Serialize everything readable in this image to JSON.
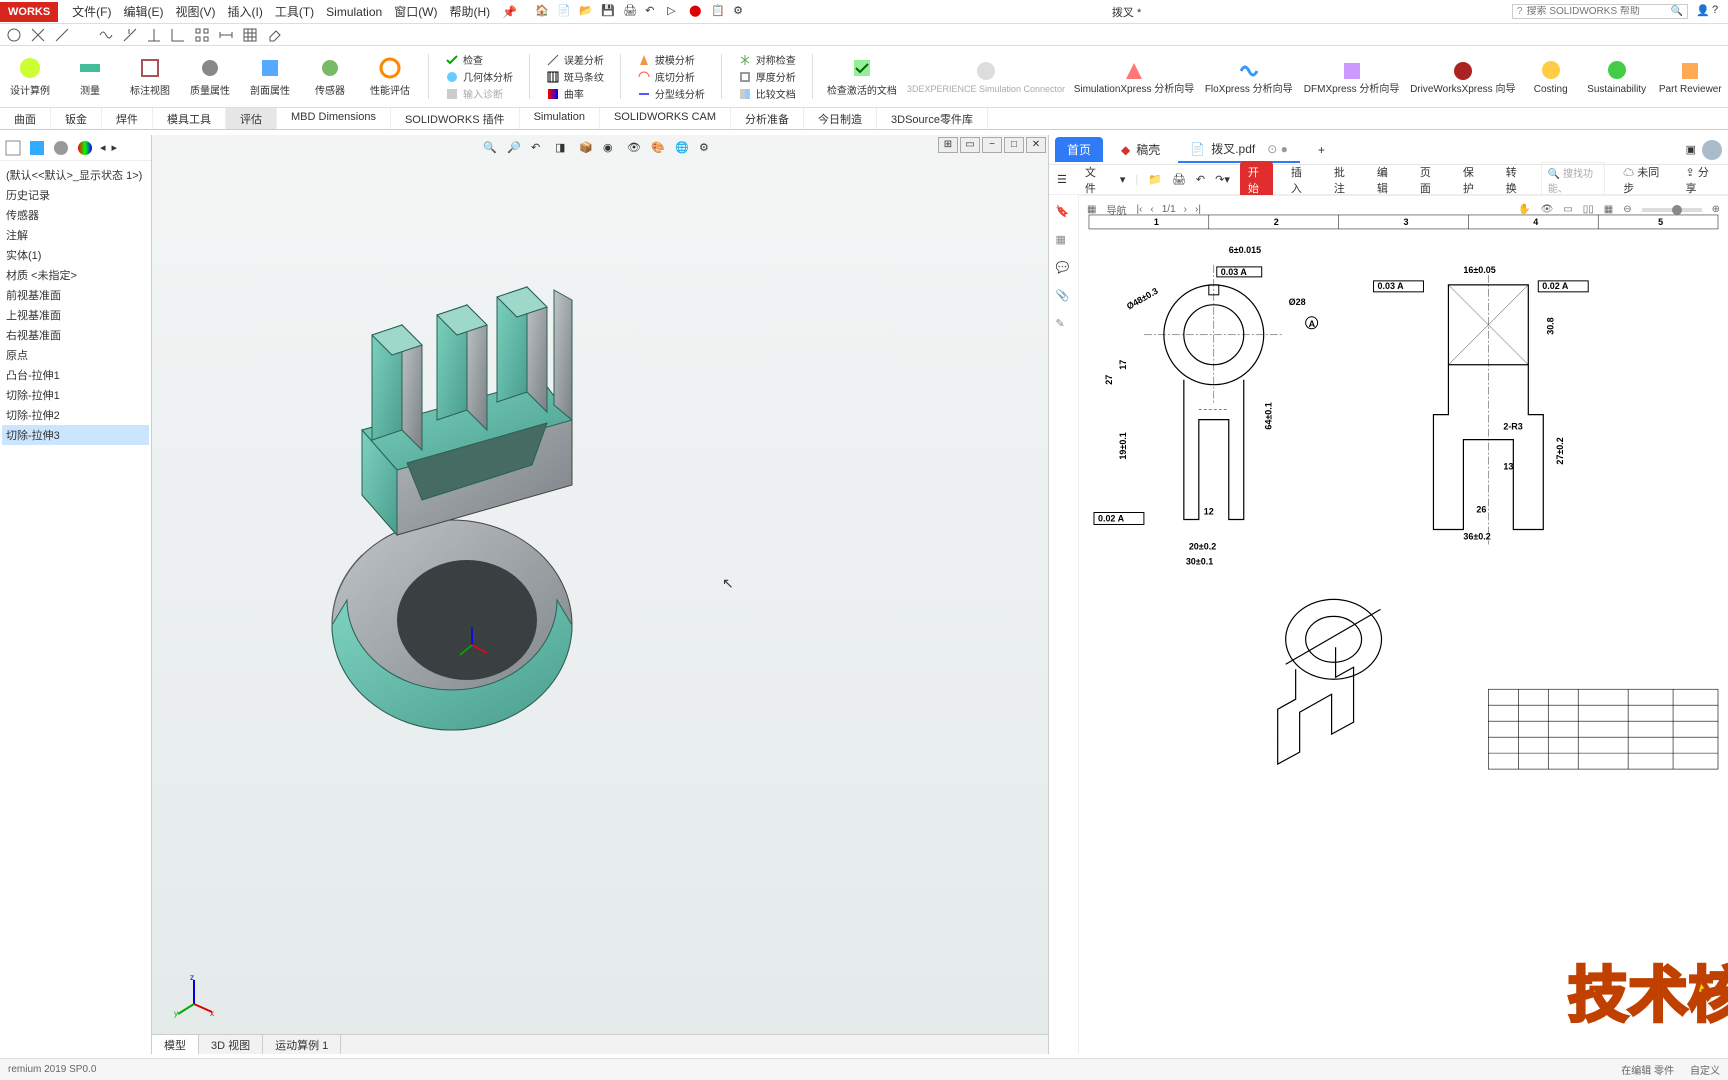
{
  "app": {
    "logo": "WORKS",
    "docTitle": "拨叉 *",
    "searchPlaceholder": "搜索 SOLIDWORKS 帮助"
  },
  "menu": [
    "文件(F)",
    "编辑(E)",
    "视图(V)",
    "插入(I)",
    "工具(T)",
    "Simulation",
    "窗口(W)",
    "帮助(H)"
  ],
  "ribbon": {
    "large": [
      {
        "icon": "#cf3",
        "label": "设计算例"
      },
      {
        "icon": "#4b9",
        "label": "测量"
      },
      {
        "icon": "#a55",
        "label": "标注视图"
      },
      {
        "icon": "#888",
        "label": "质量属性"
      },
      {
        "icon": "#5af",
        "label": "剖面属性"
      },
      {
        "icon": "#7b6",
        "label": "传感器"
      },
      {
        "icon": "#f80",
        "label": "性能评估"
      }
    ],
    "group1": [
      {
        "k": "check",
        "label": "检查"
      },
      {
        "k": "geom",
        "label": "几何体分析"
      },
      {
        "k": "diag",
        "label": "输入诊断"
      }
    ],
    "group2": [
      {
        "k": "err",
        "label": "误差分析"
      },
      {
        "k": "zebra",
        "label": "斑马条纹"
      },
      {
        "k": "curv",
        "label": "曲率"
      }
    ],
    "group3": [
      {
        "k": "mold",
        "label": "拔模分析"
      },
      {
        "k": "under",
        "label": "底切分析"
      },
      {
        "k": "part",
        "label": "分型线分析"
      }
    ],
    "group4": [
      {
        "k": "sym",
        "label": "对称检查"
      },
      {
        "k": "thick",
        "label": "厚度分析"
      },
      {
        "k": "cmp",
        "label": "比较文档"
      }
    ],
    "xlarge": [
      {
        "label": "检查激活的文档"
      },
      {
        "label": "3DEXPERIENCE Simulation Connector",
        "dim": true
      },
      {
        "label": "SimulationXpress 分析向导"
      },
      {
        "label": "FloXpress 分析向导"
      },
      {
        "label": "DFMXpress 分析向导"
      },
      {
        "label": "DriveWorksXpress 向导"
      },
      {
        "label": "Costing"
      },
      {
        "label": "Sustainability"
      },
      {
        "label": "Part Reviewer"
      }
    ]
  },
  "ribtabs": [
    "曲面",
    "钣金",
    "焊件",
    "模具工具",
    "评估",
    "MBD Dimensions",
    "SOLIDWORKS 插件",
    "Simulation",
    "SOLIDWORKS CAM",
    "分析准备",
    "今日制造",
    "3DSource零件库"
  ],
  "ribtabActive": 4,
  "tree": [
    "(默认<<默认>_显示状态 1>)",
    "历史记录",
    "传感器",
    "注解",
    "实体(1)",
    "材质 <未指定>",
    "前视基准面",
    "上视基准面",
    "右视基准面",
    "原点",
    "凸台-拉伸1",
    "切除-拉伸1",
    "切除-拉伸2",
    "切除-拉伸3"
  ],
  "treeSelected": 13,
  "viewportTabs": [
    "模型",
    "3D 视图",
    "运动算例 1"
  ],
  "viewportTabActive": 0,
  "pdf": {
    "homeTab": "首页",
    "tabs": [
      "稿壳",
      "拨叉.pdf"
    ],
    "activeTab": 1,
    "fileMenu": "文件",
    "actions": [
      "开始",
      "插入",
      "批注",
      "编辑",
      "页面",
      "保护",
      "转换"
    ],
    "searchPlaceholder": "搜找功能、",
    "sync": "未同步",
    "share": "分享",
    "navLabel": "导航",
    "page": "1/1"
  },
  "status": {
    "left": "remium 2019 SP0.0",
    "right": [
      "在编辑 零件",
      "自定义"
    ]
  },
  "watermark": "技术核",
  "drawing": {
    "dims_left": [
      "Ø48±0.3",
      "27",
      "17",
      "19±0.1",
      "0.02  A",
      "20±0.2",
      "30±0.1",
      "6±0.015",
      "64±0.1",
      "12",
      "Ø28"
    ],
    "gtol_left": "0.03  A",
    "dims_right": [
      "16±0.05",
      "30.8",
      "27±0.2",
      "13",
      "26",
      "36±0.2",
      "0.03  A",
      "0.02  A",
      "2-R3"
    ]
  }
}
